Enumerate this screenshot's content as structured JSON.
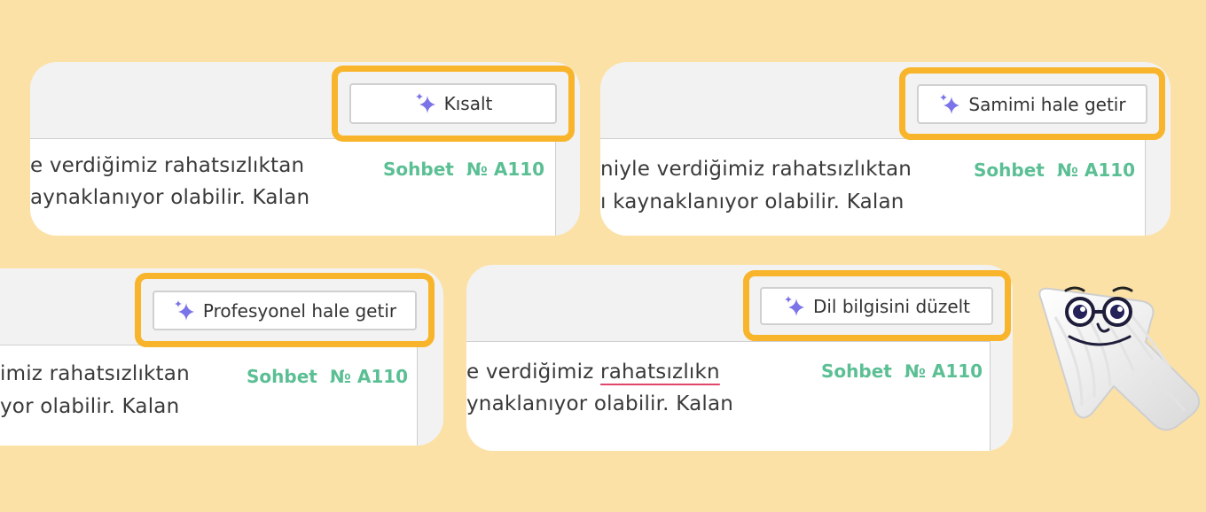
{
  "cards": [
    {
      "button_label": "Kısalt",
      "line1": "e verdiğimiz rahatsızlıktan",
      "line2": "aynaklanıyor olabilir. Kalan",
      "tag_label": "Sohbet",
      "tag_number": "№ A110"
    },
    {
      "button_label": "Samimi hale getir",
      "line1": "niyle verdiğimiz rahatsızlıktan",
      "line2": "ı kaynaklanıyor olabilir. Kalan",
      "tag_label": "Sohbet",
      "tag_number": "№ A110"
    },
    {
      "button_label": "Profesyonel hale getir",
      "line1": "imiz rahatsızlıktan",
      "line2": "yor olabilir. Kalan",
      "tag_label": "Sohbet",
      "tag_number": "№ A110"
    },
    {
      "button_label": "Dil bilgisini düzelt",
      "line1_before": "e verdiğimiz ",
      "line1_error": "rahatsızlıkn",
      "line2": "ynaklanıyor olabilir. Kalan",
      "tag_label": "Sohbet",
      "tag_number": "№ A110"
    }
  ],
  "icons": {
    "sparkle": "sparkle-icon",
    "mascot": "cursor-mascot-icon"
  },
  "colors": {
    "background": "#FCE1A7",
    "highlight": "#F8B52B",
    "tag": "#5BBF94",
    "sparkle": "#7B74E8",
    "error_underline": "#E0466A"
  }
}
